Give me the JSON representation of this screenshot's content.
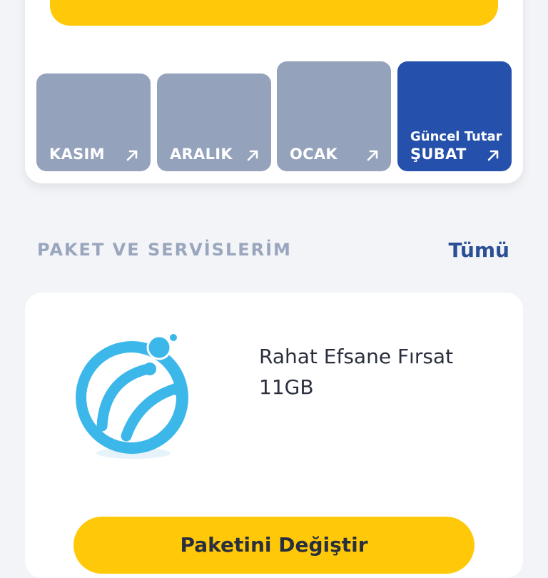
{
  "colors": {
    "accent_yellow": "#ffc90a",
    "tile_inactive": "#94a2bb",
    "tile_active": "#2550ab",
    "link_blue": "#2b4f95",
    "section_gray": "#9aa6bd",
    "logo_blue": "#3cb7ea"
  },
  "months": [
    {
      "label": "KASIM",
      "active": false,
      "icon": "arrow-up-right-icon"
    },
    {
      "label": "ARALIK",
      "active": false,
      "icon": "arrow-up-right-icon"
    },
    {
      "label": "OCAK",
      "active": false,
      "icon": "arrow-up-right-icon"
    },
    {
      "label": "ŞUBAT",
      "sublabel": "Güncel Tutar",
      "active": true,
      "icon": "arrow-up-right-icon"
    }
  ],
  "section": {
    "title": "PAKET VE SERVİSLERİM",
    "see_all_label": "Tümü"
  },
  "package": {
    "logo_icon": "turkcell-logo-icon",
    "name_line1": "Rahat Efsane Fırsat",
    "name_line2": "11GB",
    "button_label": "Paketini Değiştir"
  }
}
